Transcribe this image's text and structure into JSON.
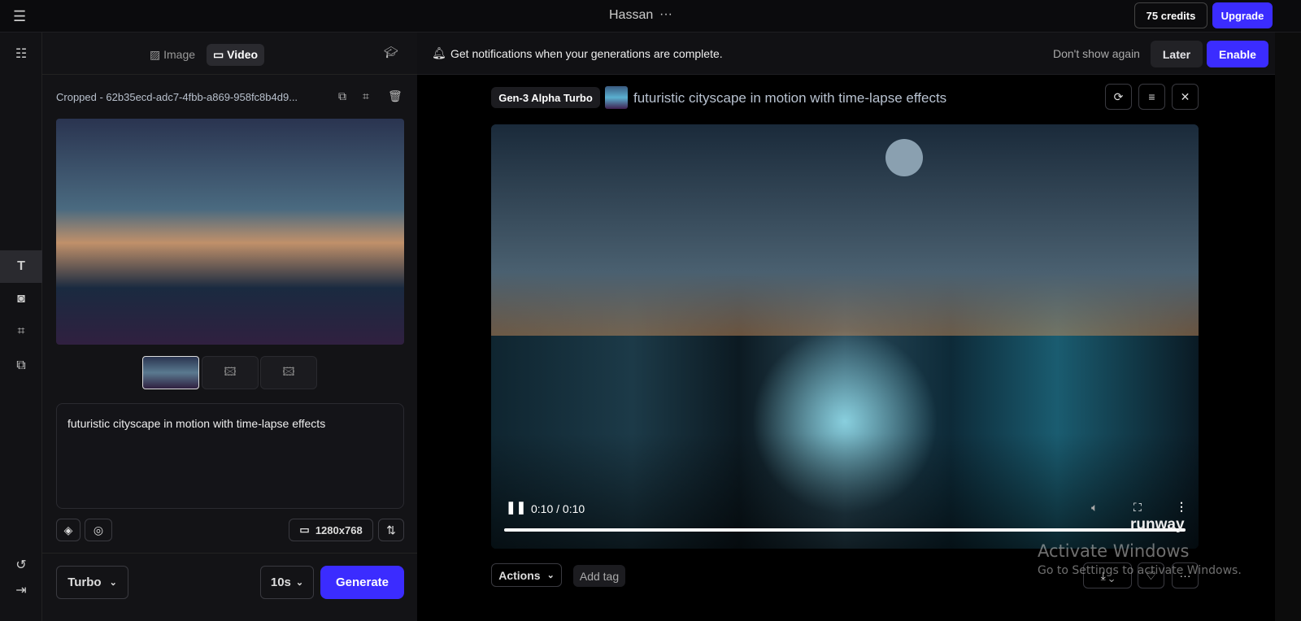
{
  "topbar": {
    "title": "Hassan",
    "more": "···",
    "credits": "75 credits",
    "upgrade": "Upgrade"
  },
  "mode_tabs": {
    "image": "Image",
    "video": "Video"
  },
  "asset": {
    "name": "Cropped - 62b35ecd-adc7-4fbb-a869-958fc8b4d9..."
  },
  "prompt": {
    "text": "futuristic cityscape in motion with time-lapse effects"
  },
  "resolution": "1280x768",
  "model_select": "Turbo",
  "duration_select": "10s",
  "generate": "Generate",
  "notification": {
    "text": "Get notifications when your generations are complete.",
    "dont_show": "Don't show again",
    "later": "Later",
    "enable": "Enable"
  },
  "generation": {
    "model_badge": "Gen-3 Alpha Turbo",
    "title": "futuristic cityscape in motion with time-lapse effects"
  },
  "player": {
    "time": "0:10 / 0:10",
    "progress": 1.0,
    "watermark": "runway"
  },
  "actions": {
    "actions_label": "Actions",
    "add_tag": "Add tag"
  },
  "watermark_os": {
    "line1": "Activate Windows",
    "line2": "Go to Settings to activate Windows."
  },
  "colors": {
    "accent": "#3b2cff"
  }
}
